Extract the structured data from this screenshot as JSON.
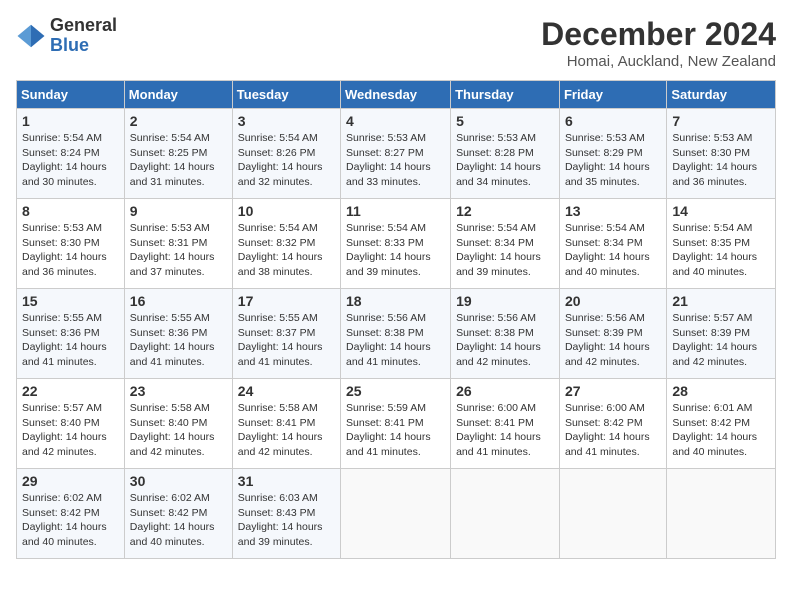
{
  "logo": {
    "general": "General",
    "blue": "Blue"
  },
  "title": "December 2024",
  "location": "Homai, Auckland, New Zealand",
  "days_of_week": [
    "Sunday",
    "Monday",
    "Tuesday",
    "Wednesday",
    "Thursday",
    "Friday",
    "Saturday"
  ],
  "weeks": [
    [
      {
        "day": "1",
        "sunrise": "5:54 AM",
        "sunset": "8:24 PM",
        "daylight": "14 hours and 30 minutes."
      },
      {
        "day": "2",
        "sunrise": "5:54 AM",
        "sunset": "8:25 PM",
        "daylight": "14 hours and 31 minutes."
      },
      {
        "day": "3",
        "sunrise": "5:54 AM",
        "sunset": "8:26 PM",
        "daylight": "14 hours and 32 minutes."
      },
      {
        "day": "4",
        "sunrise": "5:53 AM",
        "sunset": "8:27 PM",
        "daylight": "14 hours and 33 minutes."
      },
      {
        "day": "5",
        "sunrise": "5:53 AM",
        "sunset": "8:28 PM",
        "daylight": "14 hours and 34 minutes."
      },
      {
        "day": "6",
        "sunrise": "5:53 AM",
        "sunset": "8:29 PM",
        "daylight": "14 hours and 35 minutes."
      },
      {
        "day": "7",
        "sunrise": "5:53 AM",
        "sunset": "8:30 PM",
        "daylight": "14 hours and 36 minutes."
      }
    ],
    [
      {
        "day": "8",
        "sunrise": "5:53 AM",
        "sunset": "8:30 PM",
        "daylight": "14 hours and 36 minutes."
      },
      {
        "day": "9",
        "sunrise": "5:53 AM",
        "sunset": "8:31 PM",
        "daylight": "14 hours and 37 minutes."
      },
      {
        "day": "10",
        "sunrise": "5:54 AM",
        "sunset": "8:32 PM",
        "daylight": "14 hours and 38 minutes."
      },
      {
        "day": "11",
        "sunrise": "5:54 AM",
        "sunset": "8:33 PM",
        "daylight": "14 hours and 39 minutes."
      },
      {
        "day": "12",
        "sunrise": "5:54 AM",
        "sunset": "8:34 PM",
        "daylight": "14 hours and 39 minutes."
      },
      {
        "day": "13",
        "sunrise": "5:54 AM",
        "sunset": "8:34 PM",
        "daylight": "14 hours and 40 minutes."
      },
      {
        "day": "14",
        "sunrise": "5:54 AM",
        "sunset": "8:35 PM",
        "daylight": "14 hours and 40 minutes."
      }
    ],
    [
      {
        "day": "15",
        "sunrise": "5:55 AM",
        "sunset": "8:36 PM",
        "daylight": "14 hours and 41 minutes."
      },
      {
        "day": "16",
        "sunrise": "5:55 AM",
        "sunset": "8:36 PM",
        "daylight": "14 hours and 41 minutes."
      },
      {
        "day": "17",
        "sunrise": "5:55 AM",
        "sunset": "8:37 PM",
        "daylight": "14 hours and 41 minutes."
      },
      {
        "day": "18",
        "sunrise": "5:56 AM",
        "sunset": "8:38 PM",
        "daylight": "14 hours and 41 minutes."
      },
      {
        "day": "19",
        "sunrise": "5:56 AM",
        "sunset": "8:38 PM",
        "daylight": "14 hours and 42 minutes."
      },
      {
        "day": "20",
        "sunrise": "5:56 AM",
        "sunset": "8:39 PM",
        "daylight": "14 hours and 42 minutes."
      },
      {
        "day": "21",
        "sunrise": "5:57 AM",
        "sunset": "8:39 PM",
        "daylight": "14 hours and 42 minutes."
      }
    ],
    [
      {
        "day": "22",
        "sunrise": "5:57 AM",
        "sunset": "8:40 PM",
        "daylight": "14 hours and 42 minutes."
      },
      {
        "day": "23",
        "sunrise": "5:58 AM",
        "sunset": "8:40 PM",
        "daylight": "14 hours and 42 minutes."
      },
      {
        "day": "24",
        "sunrise": "5:58 AM",
        "sunset": "8:41 PM",
        "daylight": "14 hours and 42 minutes."
      },
      {
        "day": "25",
        "sunrise": "5:59 AM",
        "sunset": "8:41 PM",
        "daylight": "14 hours and 41 minutes."
      },
      {
        "day": "26",
        "sunrise": "6:00 AM",
        "sunset": "8:41 PM",
        "daylight": "14 hours and 41 minutes."
      },
      {
        "day": "27",
        "sunrise": "6:00 AM",
        "sunset": "8:42 PM",
        "daylight": "14 hours and 41 minutes."
      },
      {
        "day": "28",
        "sunrise": "6:01 AM",
        "sunset": "8:42 PM",
        "daylight": "14 hours and 40 minutes."
      }
    ],
    [
      {
        "day": "29",
        "sunrise": "6:02 AM",
        "sunset": "8:42 PM",
        "daylight": "14 hours and 40 minutes."
      },
      {
        "day": "30",
        "sunrise": "6:02 AM",
        "sunset": "8:42 PM",
        "daylight": "14 hours and 40 minutes."
      },
      {
        "day": "31",
        "sunrise": "6:03 AM",
        "sunset": "8:43 PM",
        "daylight": "14 hours and 39 minutes."
      },
      null,
      null,
      null,
      null
    ]
  ],
  "labels": {
    "sunrise": "Sunrise:",
    "sunset": "Sunset:",
    "daylight": "Daylight:"
  }
}
